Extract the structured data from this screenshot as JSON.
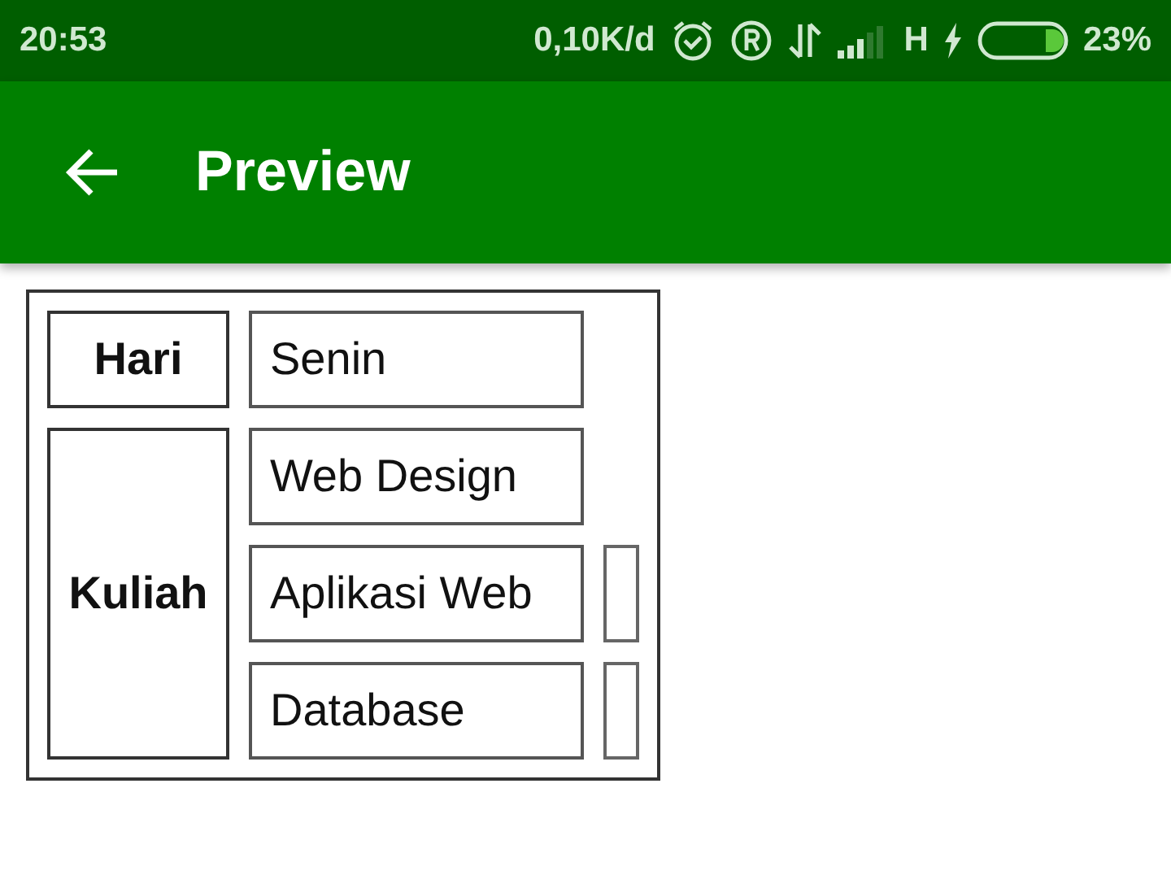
{
  "status_bar": {
    "time": "20:53",
    "speed": "0,10K/d",
    "network": "H",
    "battery": "23%"
  },
  "app_bar": {
    "title": "Preview"
  },
  "table": {
    "groups": [
      {
        "header": "Hari",
        "rows": [
          [
            {
              "kind": "text",
              "text": "Senin"
            }
          ]
        ]
      },
      {
        "header": "Kuliah",
        "rows": [
          [
            {
              "kind": "text",
              "text": "Web Design"
            }
          ],
          [
            {
              "kind": "text",
              "text": "Aplikasi Web"
            },
            {
              "kind": "empty"
            }
          ],
          [
            {
              "kind": "text",
              "text": "Database"
            },
            {
              "kind": "empty"
            }
          ]
        ]
      }
    ]
  }
}
